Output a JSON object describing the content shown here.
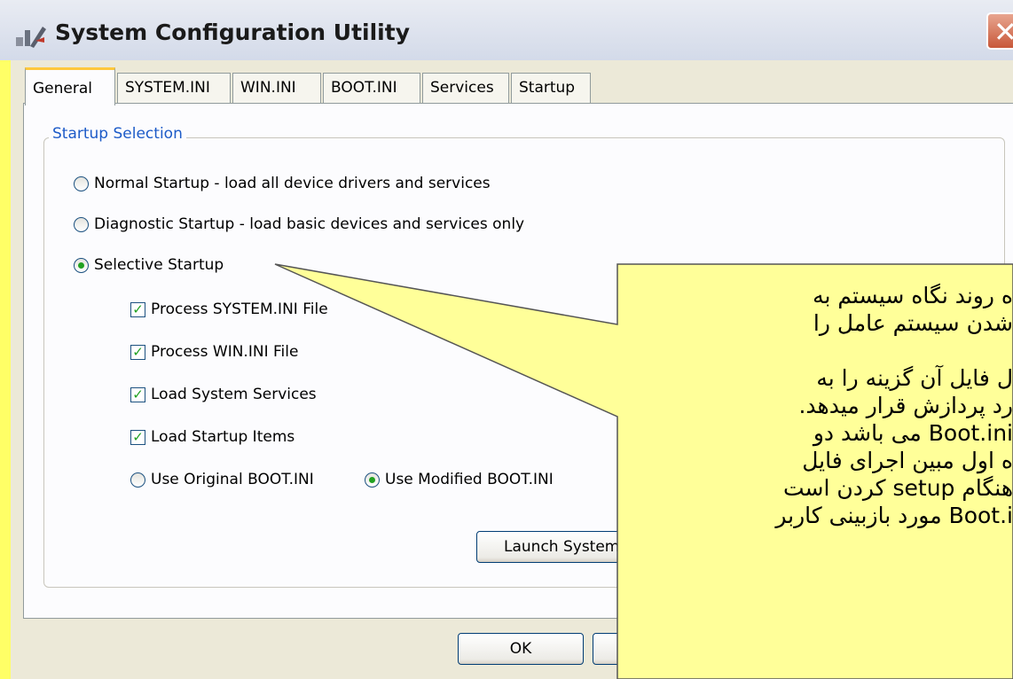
{
  "window": {
    "title": "System Configuration Utility",
    "close_glyph": "✕"
  },
  "tabs": [
    {
      "label": "General"
    },
    {
      "label": "SYSTEM.INI"
    },
    {
      "label": "WIN.INI"
    },
    {
      "label": "BOOT.INI"
    },
    {
      "label": "Services"
    },
    {
      "label": "Startup"
    }
  ],
  "group": {
    "title": "Startup Selection",
    "normal_label": "Normal Startup - load all device drivers and services",
    "diagnostic_label": "Diagnostic Startup - load basic devices and services only",
    "selective_label": "Selective Startup",
    "selected": "selective",
    "checks": [
      {
        "label": "Process SYSTEM.INI File",
        "checked": true
      },
      {
        "label": "Process WIN.INI File",
        "checked": true
      },
      {
        "label": "Load System Services",
        "checked": true
      },
      {
        "label": "Load Startup Items",
        "checked": true
      }
    ],
    "boot_original_label": "Use Original BOOT.INI",
    "boot_modified_label": "Use Modified BOOT.INI",
    "boot_selected": "modified",
    "launch_button": "Launch System Restore"
  },
  "buttons": {
    "ok": "OK"
  },
  "callout": {
    "lines": [
      "ه روند نگاه سیستم به",
      "شدن سیستم عامل را",
      "",
      "ل فایل آن گزینه را به",
      "رد پردازش قرار میدهد.",
      "Boot.ini می باشد دو",
      "ه اول مبین اجرای فایل",
      "هنگام setup کردن است",
      "Boot.i مورد بازبینی کاربر"
    ],
    "fill_color": "#ffff99",
    "border_color": "#555555"
  }
}
